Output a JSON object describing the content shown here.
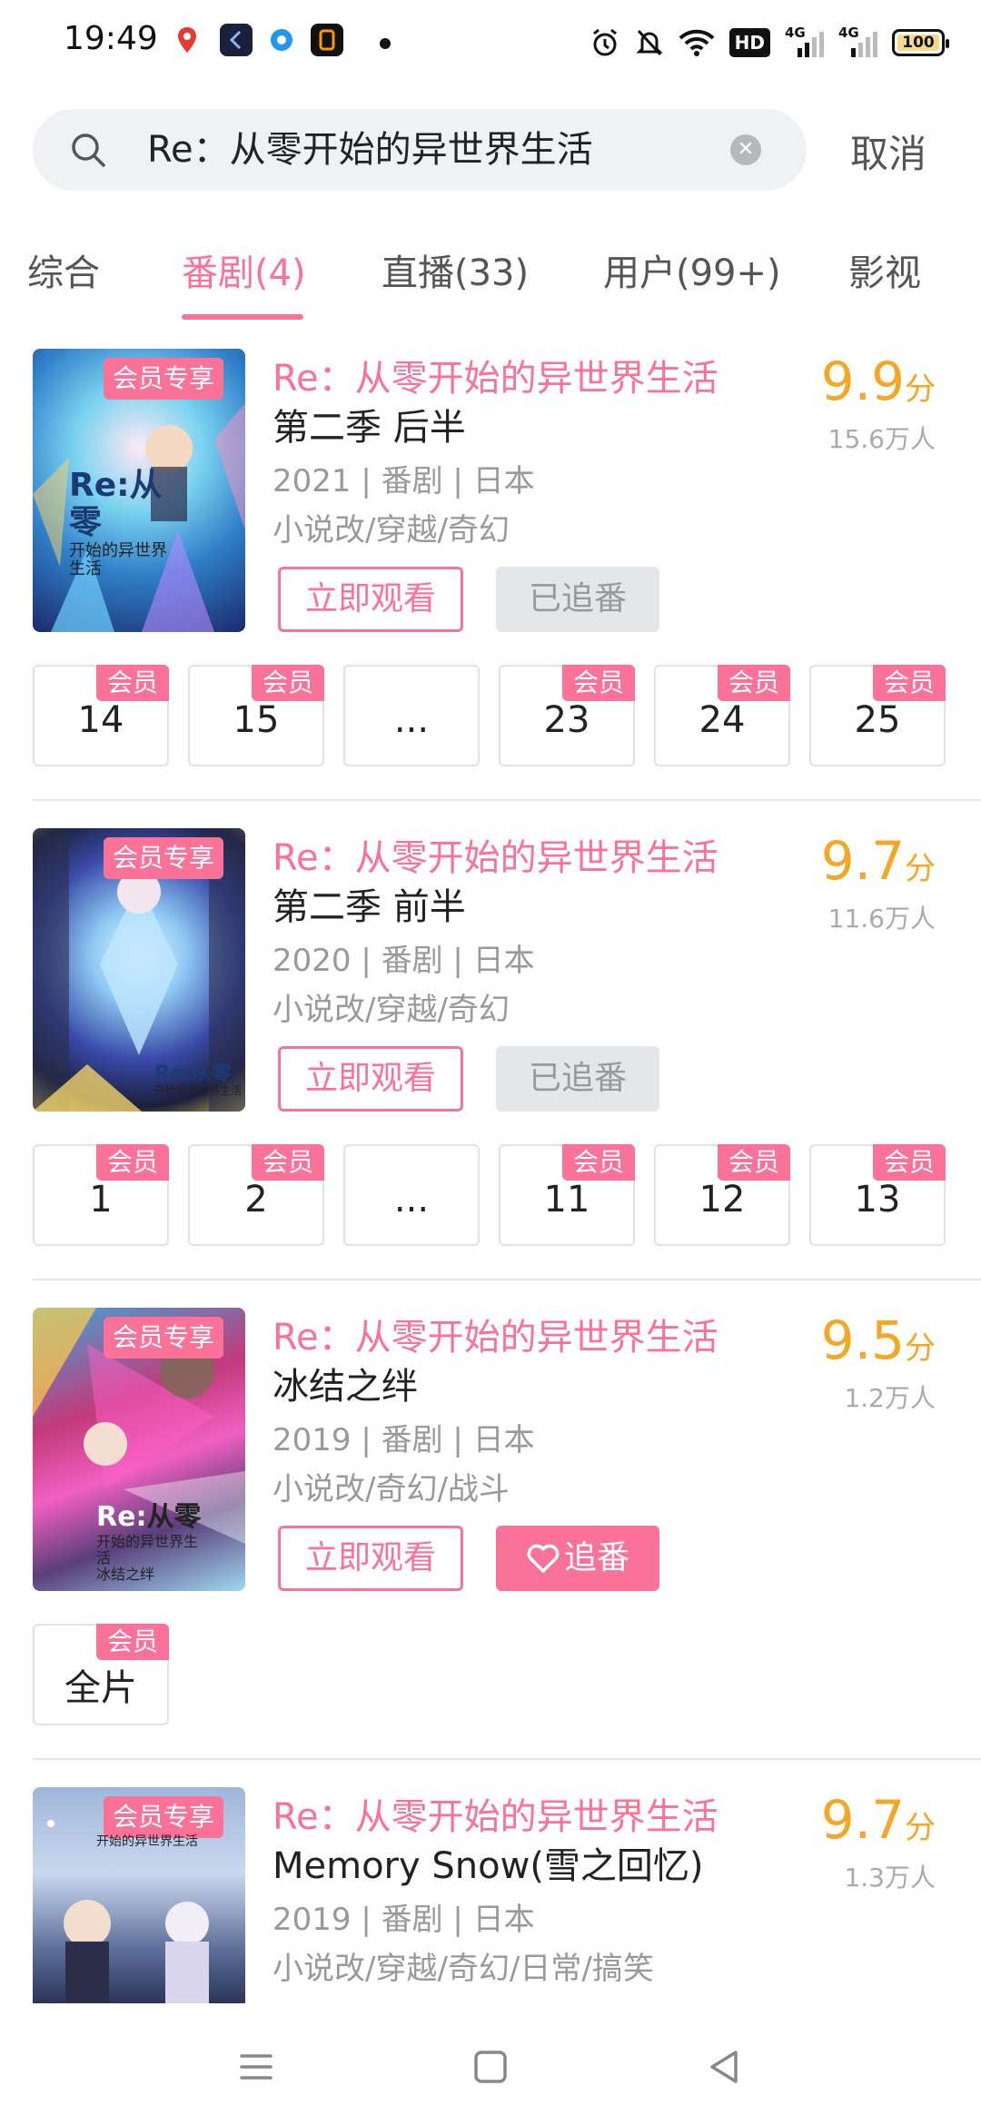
{
  "status_bar": {
    "time": "19:49",
    "battery": "100",
    "net1": "4G",
    "net2": "4G",
    "hd_label": "HD"
  },
  "search": {
    "query": "Re：从零开始的异世界生活",
    "cancel_label": "取消"
  },
  "tabs": [
    {
      "label": "综合",
      "active": false
    },
    {
      "label": "番剧(4)",
      "active": true
    },
    {
      "label": "直播(33)",
      "active": false
    },
    {
      "label": "用户(99+)",
      "active": false
    },
    {
      "label": "影视",
      "active": false
    }
  ],
  "common": {
    "vip_exclusive": "会员专享",
    "vip_badge": "会员",
    "watch_now": "立即观看",
    "followed": "已追番",
    "follow": "追番",
    "score_unit": "分"
  },
  "results": [
    {
      "title": "Re：从零开始的异世界生活",
      "subtitle": "第二季 后半",
      "meta": "2021 | 番剧 | 日本",
      "tags": "小说改/穿越/奇幻",
      "score": "9.9",
      "people": "15.6万人",
      "follow_state": "已追番",
      "episodes": [
        {
          "label": "14",
          "vip": true
        },
        {
          "label": "15",
          "vip": true
        },
        {
          "label": "...",
          "vip": false
        },
        {
          "label": "23",
          "vip": true
        },
        {
          "label": "24",
          "vip": true
        },
        {
          "label": "25",
          "vip": true
        }
      ]
    },
    {
      "title": "Re：从零开始的异世界生活",
      "subtitle": "第二季 前半",
      "meta": "2020 | 番剧 | 日本",
      "tags": "小说改/穿越/奇幻",
      "score": "9.7",
      "people": "11.6万人",
      "follow_state": "已追番",
      "episodes": [
        {
          "label": "1",
          "vip": true
        },
        {
          "label": "2",
          "vip": true
        },
        {
          "label": "...",
          "vip": false
        },
        {
          "label": "11",
          "vip": true
        },
        {
          "label": "12",
          "vip": true
        },
        {
          "label": "13",
          "vip": true
        }
      ]
    },
    {
      "title": "Re：从零开始的异世界生活",
      "subtitle": "冰结之绊",
      "meta": "2019 | 番剧 | 日本",
      "tags": "小说改/奇幻/战斗",
      "score": "9.5",
      "people": "1.2万人",
      "follow_state": "追番",
      "episodes": [
        {
          "label": "全片",
          "vip": true
        }
      ]
    },
    {
      "title": "Re：从零开始的异世界生活",
      "subtitle": "Memory Snow(雪之回忆)",
      "meta": "2019 | 番剧 | 日本",
      "tags": "小说改/穿越/奇幻/日常/搞笑",
      "score": "9.7",
      "people": "1.3万人"
    }
  ],
  "poster_logo": {
    "re": "Re:",
    "big": "从零",
    "line": "开始的异世界生活",
    "sub3": "冰结之绊"
  },
  "colors": {
    "accent": "#fb7299",
    "score": "#f5a623"
  }
}
